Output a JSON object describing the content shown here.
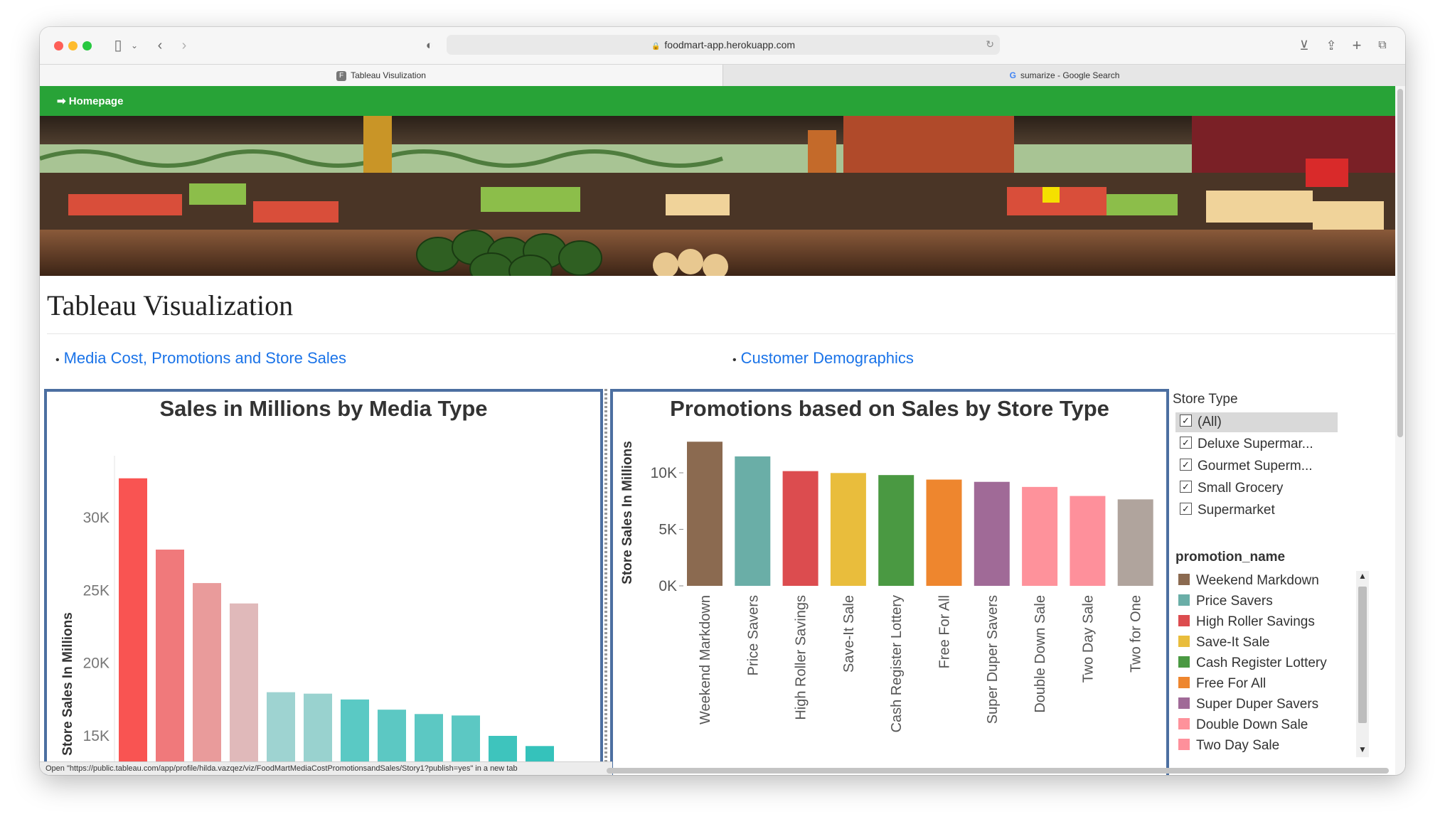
{
  "browser": {
    "url": "foodmart-app.herokuapp.com",
    "tabs": [
      {
        "label": "Tableau Visulization",
        "favicon": "F",
        "active": true
      },
      {
        "label": "sumarize - Google Search",
        "favicon": "G",
        "active": false
      }
    ]
  },
  "nav": {
    "home_label": "➡ Homepage"
  },
  "page": {
    "title": "Tableau Visualization",
    "links": [
      "Media Cost, Promotions and Store Sales",
      "Customer Demographics"
    ]
  },
  "charts": {
    "left": {
      "title": "Sales in Millions by Media Type",
      "ylabel": "Store Sales In Millions"
    },
    "right": {
      "title": "Promotions based on Sales by Store Type",
      "ylabel": "Store Sales In Millions"
    }
  },
  "chart_data": [
    {
      "type": "bar",
      "title": "Sales in Millions by Media Type",
      "ylabel": "Store Sales In Millions",
      "yticks": [
        "30K",
        "25K",
        "20K",
        "15K"
      ],
      "values": [
        32700,
        27800,
        25500,
        24100,
        18000,
        17900,
        17500,
        16800,
        16500,
        16400,
        15000,
        14300
      ],
      "colors": [
        "#f95452",
        "#f0797b",
        "#e99b9b",
        "#e0b9ba",
        "#9ed3d1",
        "#99d2cf",
        "#5ac9c4",
        "#5cc8c3",
        "#5cc8c3",
        "#5cc8c3",
        "#3ec4bd",
        "#35c2bb"
      ]
    },
    {
      "type": "bar",
      "title": "Promotions based on Sales by Store Type",
      "ylabel": "Store Sales In Millions",
      "yticks": [
        "10K",
        "5K",
        "0K"
      ],
      "categories": [
        "Weekend Markdown",
        "Price Savers",
        "High Roller Savings",
        "Save-It Sale",
        "Cash Register Lottery",
        "Free For All",
        "Super Duper Savers",
        "Double Down Sale",
        "Two Day Sale",
        "Two for One"
      ],
      "values": [
        12750,
        11450,
        10150,
        9980,
        9800,
        9400,
        9200,
        8750,
        7950,
        7650
      ],
      "colors": [
        "#8b6a50",
        "#6aaea7",
        "#dc4c4f",
        "#e9bd3c",
        "#4a9942",
        "#ee862e",
        "#a06a97",
        "#fe929b",
        "#fe909b",
        "#b0a49d"
      ]
    }
  ],
  "filters": {
    "store_type": {
      "title": "Store Type",
      "options": [
        "(All)",
        "Deluxe Supermar...",
        "Gourmet Superm...",
        "Small Grocery",
        "Supermarket"
      ]
    },
    "promotion": {
      "title": "promotion_name",
      "items": [
        {
          "label": "Weekend Markdown",
          "color": "#8b6a50"
        },
        {
          "label": "Price Savers",
          "color": "#6aaea7"
        },
        {
          "label": "High Roller Savings",
          "color": "#dc4c4f"
        },
        {
          "label": "Save-It Sale",
          "color": "#e9bd3c"
        },
        {
          "label": "Cash Register Lottery",
          "color": "#4a9942"
        },
        {
          "label": "Free For All",
          "color": "#ee862e"
        },
        {
          "label": "Super Duper Savers",
          "color": "#a06a97"
        },
        {
          "label": "Double Down Sale",
          "color": "#fe929b"
        },
        {
          "label": "Two Day Sale",
          "color": "#fe909b"
        }
      ]
    }
  },
  "status_bar": "Open \"https://public.tableau.com/app/profile/hilda.vazqez/viz/FoodMartMediaCostPromotionsandSales/Story1?publish=yes\" in a new tab"
}
